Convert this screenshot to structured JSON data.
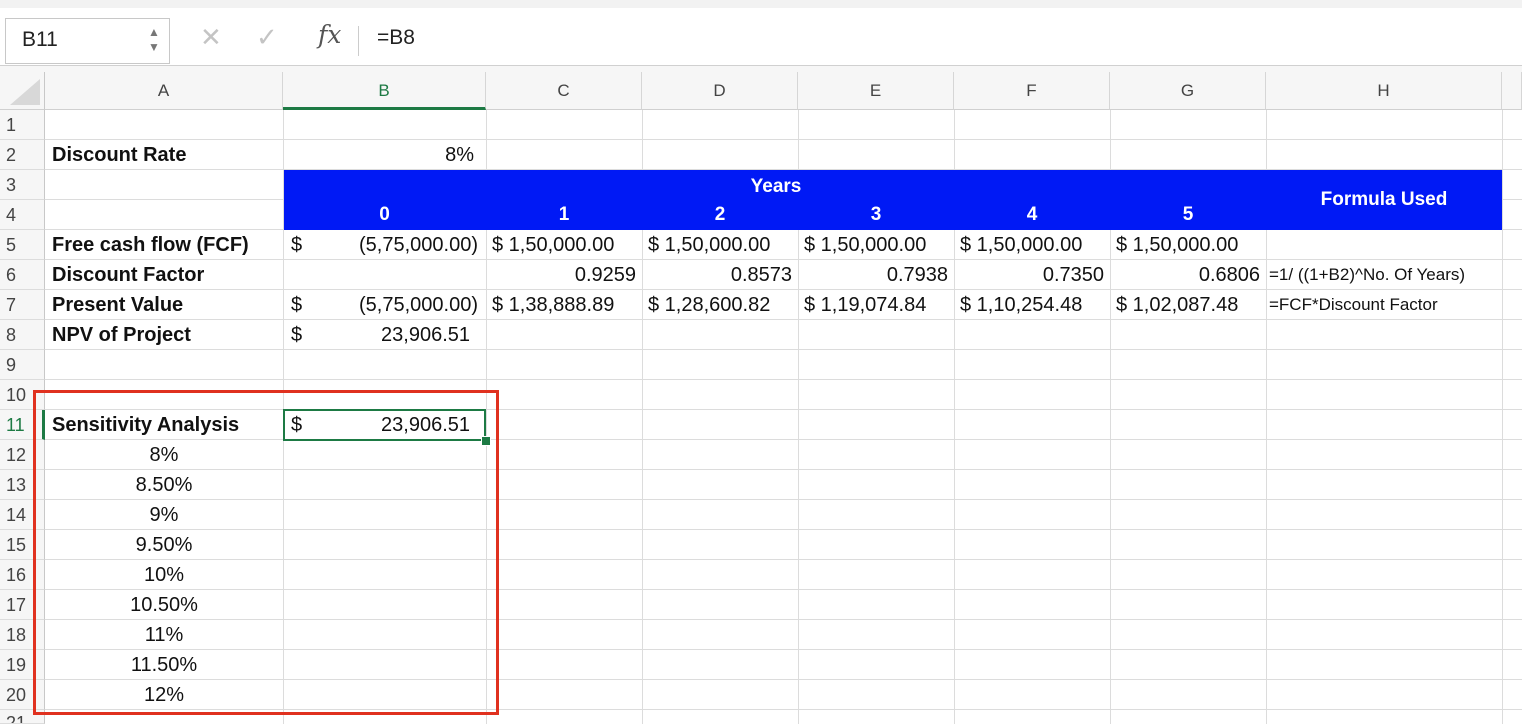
{
  "name_box": "B11",
  "formula": "=B8",
  "fx_label": "fx",
  "columns": [
    "A",
    "B",
    "C",
    "D",
    "E",
    "F",
    "G",
    "H"
  ],
  "rows": [
    "1",
    "2",
    "3",
    "4",
    "5",
    "6",
    "7",
    "8",
    "9",
    "10",
    "11",
    "12",
    "13",
    "14",
    "15",
    "16",
    "17",
    "18",
    "19",
    "20",
    "21"
  ],
  "selected_cell": "B11",
  "accent": "#1d7a44",
  "header_fill": "#0019f5",
  "highlight_color": "#e0311f",
  "cells": {
    "a2": "Discount Rate",
    "b2": "8%",
    "years_header": "Years",
    "formula_used_header": "Formula Used",
    "year_labels": [
      "0",
      "1",
      "2",
      "3",
      "4",
      "5"
    ],
    "a5": "Free cash flow (FCF)",
    "b5_currency": "$",
    "b5": "(5,75,000.00)",
    "fcf": [
      "$ 1,50,000.00",
      "$ 1,50,000.00",
      "$ 1,50,000.00",
      "$ 1,50,000.00",
      "$ 1,50,000.00"
    ],
    "a6": "Discount Factor",
    "discount_factors": [
      "0.9259",
      "0.8573",
      "0.7938",
      "0.7350",
      "0.6806"
    ],
    "h6": "=1/ ((1+B2)^No. Of Years)",
    "a7": "Present Value",
    "b7_currency": "$",
    "b7": "(5,75,000.00)",
    "present_values": [
      "$ 1,38,888.89",
      "$ 1,28,600.82",
      "$ 1,19,074.84",
      "$ 1,10,254.48",
      "$ 1,02,087.48"
    ],
    "h7": "=FCF*Discount Factor",
    "a8": "NPV of Project",
    "b8_currency": "$",
    "b8": "23,906.51",
    "a11": "Sensitivity Analysis",
    "b11_currency": "$",
    "b11": "23,906.51",
    "sensitivity_rates": [
      "8%",
      "8.50%",
      "9%",
      "9.50%",
      "10%",
      "10.50%",
      "11%",
      "11.50%",
      "12%"
    ]
  }
}
